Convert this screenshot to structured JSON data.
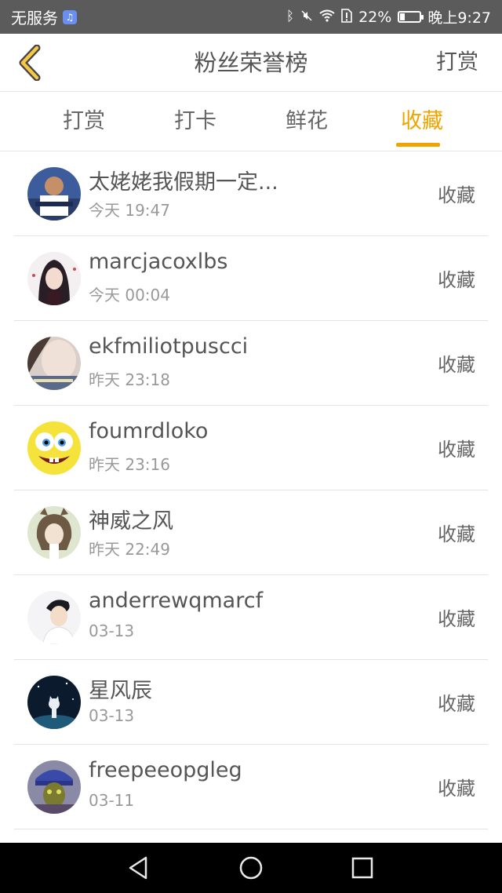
{
  "status_bar": {
    "carrier": "无服务",
    "battery": "22%",
    "time": "晚上9:27"
  },
  "header": {
    "back_icon": "chevron-left-icon",
    "title": "粉丝荣誉榜",
    "action_label": "打赏"
  },
  "tabs": [
    {
      "label": "打赏",
      "active": false
    },
    {
      "label": "打卡",
      "active": false
    },
    {
      "label": "鲜花",
      "active": false
    },
    {
      "label": "收藏",
      "active": true
    }
  ],
  "colors": {
    "accent": "#f0a400",
    "status_bar_bg": "#5b5b5b"
  },
  "list": [
    {
      "name": "太姥姥我假期一定...",
      "time": "今天 19:47",
      "action": "收藏"
    },
    {
      "name": "marcjacoxlbs",
      "time": "今天 00:04",
      "action": "收藏"
    },
    {
      "name": "ekfmiliotpuscci",
      "time": "昨天 23:18",
      "action": "收藏"
    },
    {
      "name": "foumrdloko",
      "time": "昨天 23:16",
      "action": "收藏"
    },
    {
      "name": "神威之风",
      "time": "昨天 22:49",
      "action": "收藏"
    },
    {
      "name": "anderrewqmarcf",
      "time": "03-13",
      "action": "收藏"
    },
    {
      "name": "星风辰",
      "time": "03-13",
      "action": "收藏"
    },
    {
      "name": "freepeeopgleg",
      "time": "03-11",
      "action": "收藏"
    }
  ]
}
